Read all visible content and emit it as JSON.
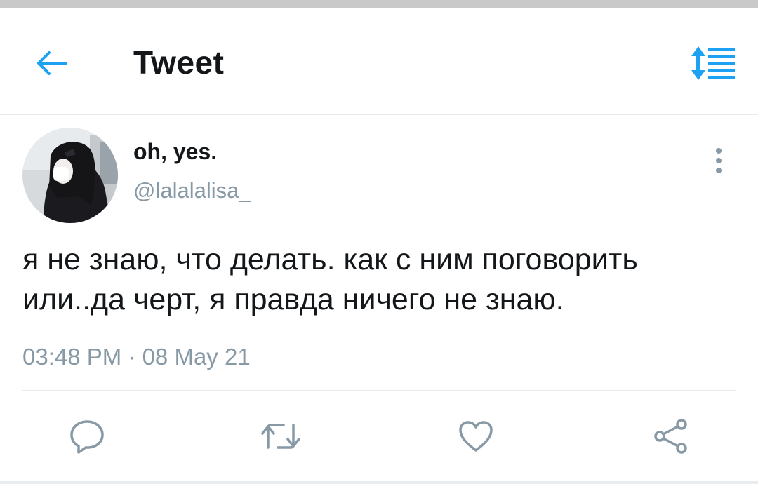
{
  "header": {
    "title": "Tweet",
    "back_icon": "arrow-left-icon",
    "sort_icon": "sort-list-icon"
  },
  "tweet": {
    "display_name": "oh, yes.",
    "handle": "@lalalalisa_",
    "text": "я не знаю, что делать. как с ним поговорить или..да черт, я правда ничего не знаю.",
    "timestamp": "03:48 PM · 08 May 21"
  },
  "actions": [
    {
      "name": "reply",
      "icon": "reply-bubble-icon"
    },
    {
      "name": "retweet",
      "icon": "retweet-icon"
    },
    {
      "name": "like",
      "icon": "heart-icon"
    },
    {
      "name": "share",
      "icon": "share-icon"
    }
  ],
  "colors": {
    "accent": "#1da1f2",
    "text": "#14171a",
    "muted": "#8899a6",
    "divider": "#e6ecf0"
  }
}
